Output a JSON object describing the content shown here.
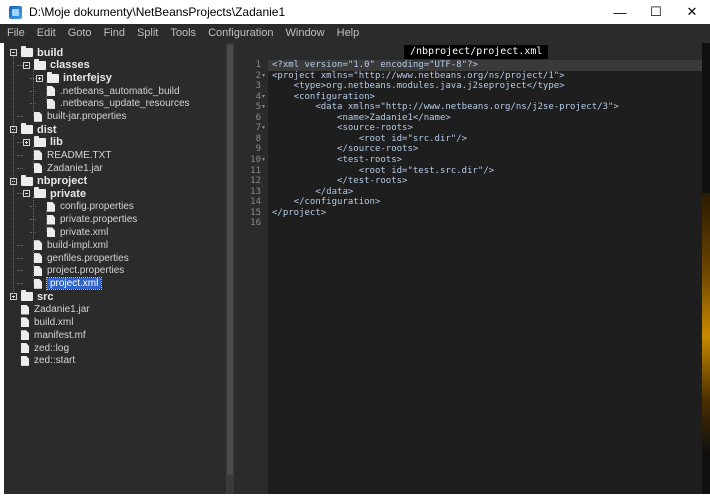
{
  "window": {
    "title": "D:\\Moje dokumenty\\NetBeansProjects\\Zadanie1",
    "minimize": "—",
    "maximize": "☐",
    "close": "✕"
  },
  "menu": [
    "File",
    "Edit",
    "Goto",
    "Find",
    "Split",
    "Tools",
    "Configuration",
    "Window",
    "Help"
  ],
  "tree": [
    {
      "label": "build",
      "type": "folder",
      "depth": 0,
      "toggle": "minus"
    },
    {
      "label": "classes",
      "type": "folder",
      "depth": 1,
      "toggle": "minus"
    },
    {
      "label": "interfejsy",
      "type": "folder",
      "depth": 2,
      "toggle": "plus"
    },
    {
      "label": ".netbeans_automatic_build",
      "type": "file",
      "depth": 2
    },
    {
      "label": ".netbeans_update_resources",
      "type": "file",
      "depth": 2
    },
    {
      "label": "built-jar.properties",
      "type": "file",
      "depth": 1
    },
    {
      "label": "dist",
      "type": "folder",
      "depth": 0,
      "toggle": "minus"
    },
    {
      "label": "lib",
      "type": "folder",
      "depth": 1,
      "toggle": "plus"
    },
    {
      "label": "README.TXT",
      "type": "file",
      "depth": 1
    },
    {
      "label": "Zadanie1.jar",
      "type": "file",
      "depth": 1
    },
    {
      "label": "nbproject",
      "type": "folder",
      "depth": 0,
      "toggle": "minus"
    },
    {
      "label": "private",
      "type": "folder",
      "depth": 1,
      "toggle": "minus"
    },
    {
      "label": "config.properties",
      "type": "file",
      "depth": 2
    },
    {
      "label": "private.properties",
      "type": "file",
      "depth": 2
    },
    {
      "label": "private.xml",
      "type": "file",
      "depth": 2
    },
    {
      "label": "build-impl.xml",
      "type": "file",
      "depth": 1
    },
    {
      "label": "genfiles.properties",
      "type": "file",
      "depth": 1
    },
    {
      "label": "project.properties",
      "type": "file",
      "depth": 1
    },
    {
      "label": "project.xml",
      "type": "file",
      "depth": 1,
      "selected": true
    },
    {
      "label": "src",
      "type": "folder",
      "depth": 0,
      "toggle": "plus"
    },
    {
      "label": "Zadanie1.jar",
      "type": "file",
      "depth": 0
    },
    {
      "label": "build.xml",
      "type": "file",
      "depth": 0
    },
    {
      "label": "manifest.mf",
      "type": "file",
      "depth": 0
    },
    {
      "label": "zed::log",
      "type": "file",
      "depth": 0
    },
    {
      "label": "zed::start",
      "type": "file",
      "depth": 0
    }
  ],
  "editor": {
    "tab_label": "/nbproject/project.xml",
    "lines": [
      {
        "n": "1",
        "fold": "",
        "text": "<?xml version=\"1.0\" encoding=\"UTF-8\"?>"
      },
      {
        "n": "2",
        "fold": "▾",
        "text": "<project xmlns=\"http://www.netbeans.org/ns/project/1\">"
      },
      {
        "n": "3",
        "fold": "",
        "text": "    <type>org.netbeans.modules.java.j2seproject</type>"
      },
      {
        "n": "4",
        "fold": "▾",
        "text": "    <configuration>"
      },
      {
        "n": "5",
        "fold": "▾",
        "text": "        <data xmlns=\"http://www.netbeans.org/ns/j2se-project/3\">"
      },
      {
        "n": "6",
        "fold": "",
        "text": "            <name>Zadanie1</name>"
      },
      {
        "n": "7",
        "fold": "▾",
        "text": "            <source-roots>"
      },
      {
        "n": "8",
        "fold": "",
        "text": "                <root id=\"src.dir\"/>"
      },
      {
        "n": "9",
        "fold": "",
        "text": "            </source-roots>"
      },
      {
        "n": "10",
        "fold": "▾",
        "text": "            <test-roots>"
      },
      {
        "n": "11",
        "fold": "",
        "text": "                <root id=\"test.src.dir\"/>"
      },
      {
        "n": "12",
        "fold": "",
        "text": "            </test-roots>"
      },
      {
        "n": "13",
        "fold": "",
        "text": "        </data>"
      },
      {
        "n": "14",
        "fold": "",
        "text": "    </configuration>"
      },
      {
        "n": "15",
        "fold": "",
        "text": "</project>"
      },
      {
        "n": "16",
        "fold": "",
        "text": ""
      }
    ]
  },
  "colors": {
    "tree_bg": "#2b2b2b",
    "editor_bg": "#1e1e1e",
    "selection": "#2f65ca",
    "code_text": "#b5cbe8"
  }
}
